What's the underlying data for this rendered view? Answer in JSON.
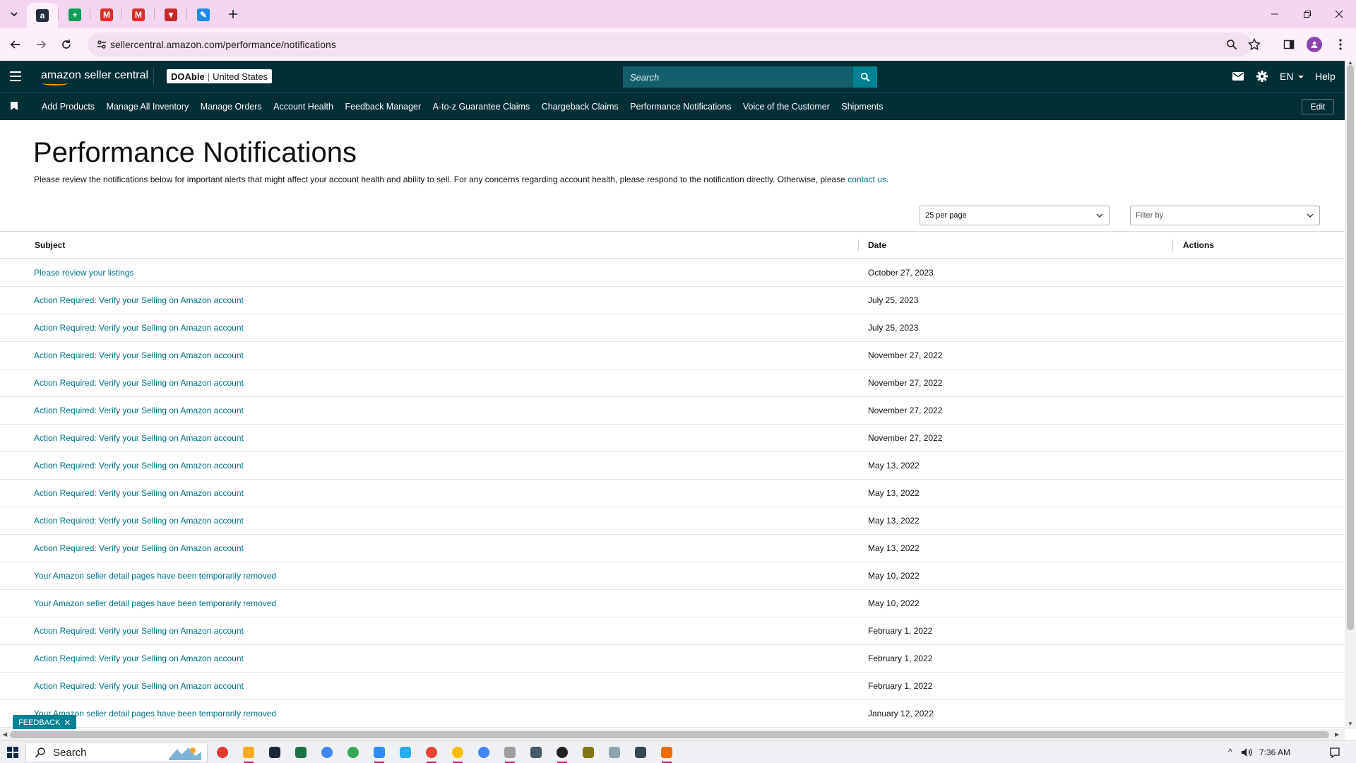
{
  "browser": {
    "url": "sellercentral.amazon.com/performance/notifications",
    "tabs": [
      {
        "icon": "amazon-favicon",
        "color": "#232f3e",
        "glyph": "a"
      },
      {
        "icon": "google-sheets-favicon",
        "color": "#0f9d58",
        "glyph": "+"
      },
      {
        "icon": "gmail-favicon",
        "color": "#d93025",
        "glyph": "M"
      },
      {
        "icon": "gmail-favicon",
        "color": "#d93025",
        "glyph": "M"
      },
      {
        "icon": "vpn-favicon",
        "color": "#c62828",
        "glyph": "▼"
      },
      {
        "icon": "edit-favicon",
        "color": "#1e88e5",
        "glyph": "✎"
      }
    ]
  },
  "header": {
    "logo_text": "amazon seller central",
    "account_name": "DOAble",
    "account_region": "United States",
    "search_placeholder": "Search",
    "language": "EN",
    "help": "Help"
  },
  "nav": {
    "links": [
      "Add Products",
      "Manage All Inventory",
      "Manage Orders",
      "Account Health",
      "Feedback Manager",
      "A-to-z Guarantee Claims",
      "Chargeback Claims",
      "Performance Notifications",
      "Voice of the Customer",
      "Shipments"
    ],
    "edit": "Edit"
  },
  "page": {
    "title": "Performance Notifications",
    "intro": "Please review the notifications below for important alerts that might affect your account health and ability to sell. For any concerns regarding account health, please respond to the notification directly. Otherwise, please ",
    "intro_link": "contact us",
    "intro_end": ".",
    "per_page": "25 per page",
    "filter_placeholder": "Filter by"
  },
  "table": {
    "columns": [
      "Subject",
      "Date",
      "Actions"
    ],
    "rows": [
      {
        "subject": "Please review your listings",
        "date": "October 27, 2023"
      },
      {
        "subject": "Action Required: Verify your Selling on Amazon account",
        "date": "July 25, 2023"
      },
      {
        "subject": "Action Required: Verify your Selling on Amazon account",
        "date": "July 25, 2023"
      },
      {
        "subject": "Action Required: Verify your Selling on Amazon account",
        "date": "November 27, 2022"
      },
      {
        "subject": "Action Required: Verify your Selling on Amazon account",
        "date": "November 27, 2022"
      },
      {
        "subject": "Action Required: Verify your Selling on Amazon account",
        "date": "November 27, 2022"
      },
      {
        "subject": "Action Required: Verify your Selling on Amazon account",
        "date": "November 27, 2022"
      },
      {
        "subject": "Action Required: Verify your Selling on Amazon account",
        "date": "May 13, 2022"
      },
      {
        "subject": "Action Required: Verify your Selling on Amazon account",
        "date": "May 13, 2022"
      },
      {
        "subject": "Action Required: Verify your Selling on Amazon account",
        "date": "May 13, 2022"
      },
      {
        "subject": "Action Required: Verify your Selling on Amazon account",
        "date": "May 13, 2022"
      },
      {
        "subject": "Your Amazon seller detail pages have been temporarily removed",
        "date": "May 10, 2022"
      },
      {
        "subject": "Your Amazon seller detail pages have been temporarily removed",
        "date": "May 10, 2022"
      },
      {
        "subject": "Action Required: Verify your Selling on Amazon account",
        "date": "February 1, 2022"
      },
      {
        "subject": "Action Required: Verify your Selling on Amazon account",
        "date": "February 1, 2022"
      },
      {
        "subject": "Action Required: Verify your Selling on Amazon account",
        "date": "February 1, 2022"
      },
      {
        "subject": "Your Amazon seller detail pages have been temporarily removed",
        "date": "January 12, 2022"
      }
    ]
  },
  "feedback": "FEEDBACK",
  "taskbar": {
    "search_placeholder": "Search",
    "time": "7:36 AM",
    "apps": [
      {
        "name": "recorder-app-icon",
        "color": "#e53935"
      },
      {
        "name": "file-explorer-icon",
        "color": "#f9a825"
      },
      {
        "name": "steam-icon",
        "color": "#1b2838"
      },
      {
        "name": "excel-icon",
        "color": "#1e7145"
      },
      {
        "name": "chrome-icon",
        "color": "#4285f4"
      },
      {
        "name": "chrome-icon",
        "color": "#34a853"
      },
      {
        "name": "zoom-icon",
        "color": "#2d8cff"
      },
      {
        "name": "telegram-icon",
        "color": "#2aabee"
      },
      {
        "name": "chrome-icon",
        "color": "#ea4335"
      },
      {
        "name": "chrome-icon",
        "color": "#fbbc05"
      },
      {
        "name": "chrome-icon",
        "color": "#4285f4"
      },
      {
        "name": "paint-icon",
        "color": "#9e9e9e"
      },
      {
        "name": "calculator-icon",
        "color": "#455a64"
      },
      {
        "name": "obs-icon",
        "color": "#212121"
      },
      {
        "name": "sticky-notes-icon",
        "color": "#827717"
      },
      {
        "name": "notepad-icon",
        "color": "#90a4ae"
      },
      {
        "name": "settings-icon",
        "color": "#37474f"
      },
      {
        "name": "paint-app-icon",
        "color": "#ef6c00"
      }
    ]
  },
  "colors": {
    "header_bg": "#002f36",
    "link": "#007185",
    "search_btn": "#008296",
    "tabstrip": "#f5d6f0"
  }
}
